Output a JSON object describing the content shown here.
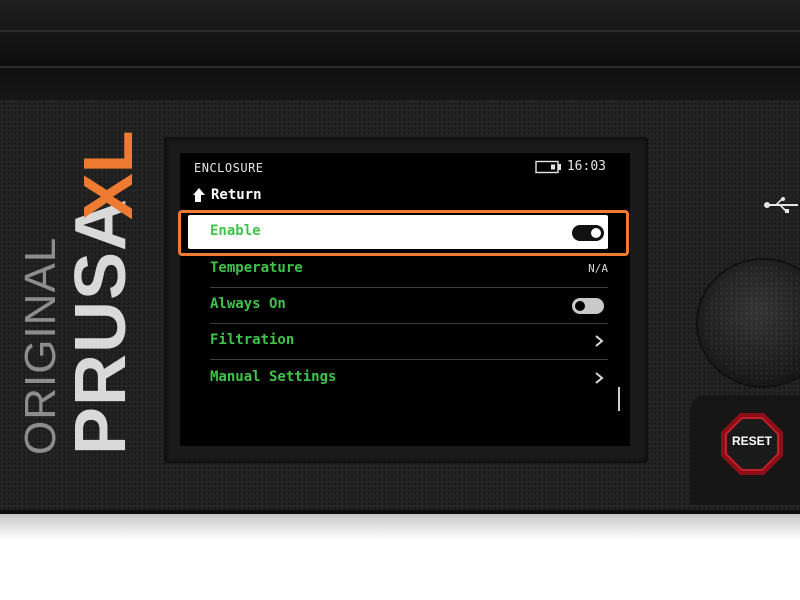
{
  "device": {
    "brand_line1": "ORIGINAL",
    "brand_line2": "PRUSA",
    "brand_model": "XL",
    "accent_color": "#ee7b31",
    "reset_label": "RESET"
  },
  "screen": {
    "header": {
      "title": "ENCLOSURE",
      "time": "16:03",
      "status_icon": "usb-drive-icon"
    },
    "return_label": "Return",
    "menu_items": [
      {
        "label": "Enable",
        "control": "toggle",
        "state": "on",
        "selected": true
      },
      {
        "label": "Temperature",
        "value": "N/A"
      },
      {
        "label": "Always On",
        "control": "toggle",
        "state": "off"
      },
      {
        "label": "Filtration",
        "control": "chevron-right-icon"
      },
      {
        "label": "Manual Settings",
        "control": "chevron-right-icon"
      }
    ],
    "text_color": "#3fc34a"
  }
}
